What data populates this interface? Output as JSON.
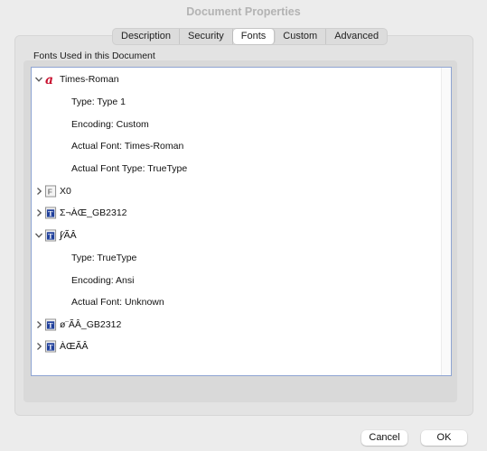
{
  "window": {
    "title": "Document Properties"
  },
  "tabs": [
    {
      "label": "Description",
      "name": "tab-description"
    },
    {
      "label": "Security",
      "name": "tab-security"
    },
    {
      "label": "Fonts",
      "name": "tab-fonts",
      "active": true
    },
    {
      "label": "Custom",
      "name": "tab-custom"
    },
    {
      "label": "Advanced",
      "name": "tab-advanced"
    }
  ],
  "fonts_section": {
    "label": "Fonts Used in this Document",
    "tree": [
      {
        "name": "Times-Roman",
        "icon": "adobe-acrobat-font-icon",
        "expanded": true,
        "details": [
          "Type: Type 1",
          "Encoding: Custom",
          "Actual Font: Times-Roman",
          "Actual Font Type: TrueType"
        ]
      },
      {
        "name": "X0",
        "icon": "type3-font-icon",
        "expanded": false,
        "details": []
      },
      {
        "name": "Σ¬ÀŒ_GB2312",
        "icon": "truetype-font-icon",
        "expanded": false,
        "details": []
      },
      {
        "name": "∫⁄ÃÂ",
        "icon": "truetype-font-icon",
        "expanded": true,
        "details": [
          "Type: TrueType",
          "Encoding: Ansi",
          "Actual Font: Unknown"
        ]
      },
      {
        "name": "ø¨ÃÂ_GB2312",
        "icon": "truetype-font-icon",
        "expanded": false,
        "details": []
      },
      {
        "name": "ÀŒÃÂ",
        "icon": "truetype-font-icon",
        "expanded": false,
        "details": []
      }
    ]
  },
  "buttons": {
    "cancel": "Cancel",
    "ok": "OK"
  },
  "colors": {
    "accent": "#8ea4d2",
    "background": "#ececec",
    "adobe_red": "#c8102e",
    "truetype_blue": "#1f3f9b"
  }
}
